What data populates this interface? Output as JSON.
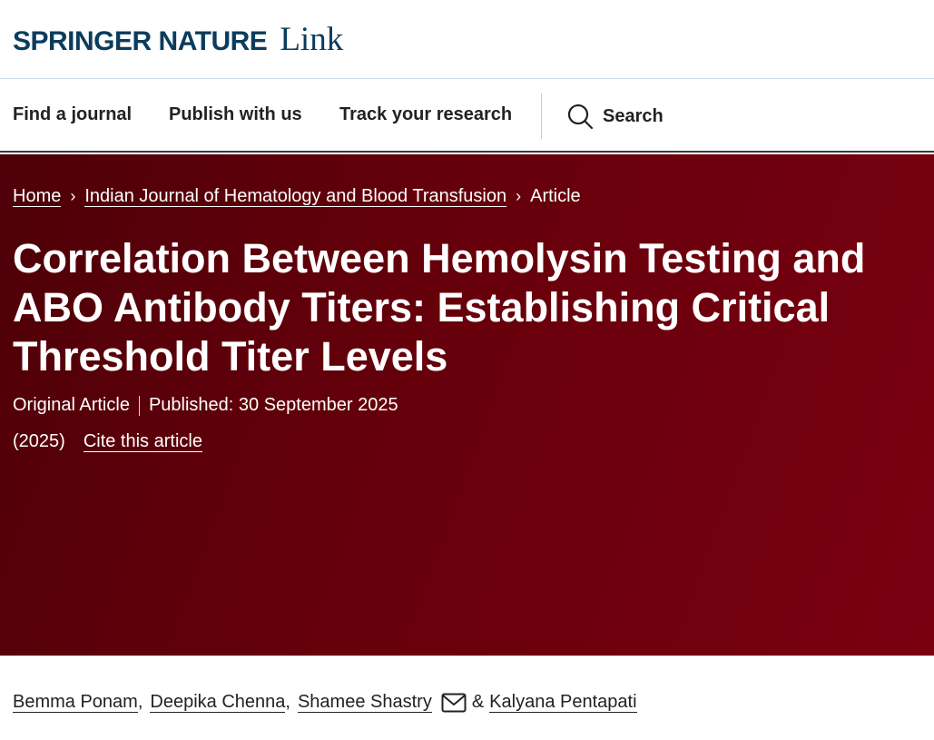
{
  "brand": {
    "name": "Springer Nature",
    "product": "Link"
  },
  "nav": {
    "items": [
      {
        "label": "Find a journal"
      },
      {
        "label": "Publish with us"
      },
      {
        "label": "Track your research"
      }
    ],
    "search_label": "Search"
  },
  "breadcrumb": {
    "items": [
      {
        "label": "Home"
      },
      {
        "label": "Indian Journal of Hematology and Blood Transfusion"
      }
    ],
    "current": "Article"
  },
  "article": {
    "title": "Correlation Between Hemolysin Testing and ABO Antibody Titers: Establishing Critical Threshold Titer Levels",
    "type": "Original Article",
    "published": "Published: 30 September 2025",
    "year": "(2025)",
    "cite_label": "Cite this article",
    "authors": [
      {
        "name": "Bemma Ponam",
        "sep": ","
      },
      {
        "name": "Deepika Chenna",
        "sep": ","
      },
      {
        "name": "Shamee Shastry",
        "sep": ""
      },
      {
        "name": "Kalyana Pentapati",
        "sep": ""
      }
    ],
    "amp": "&"
  },
  "colors": {
    "brand": "#0b3c5d",
    "hero_dark": "#4e0008",
    "hero_light": "#7a0010"
  }
}
